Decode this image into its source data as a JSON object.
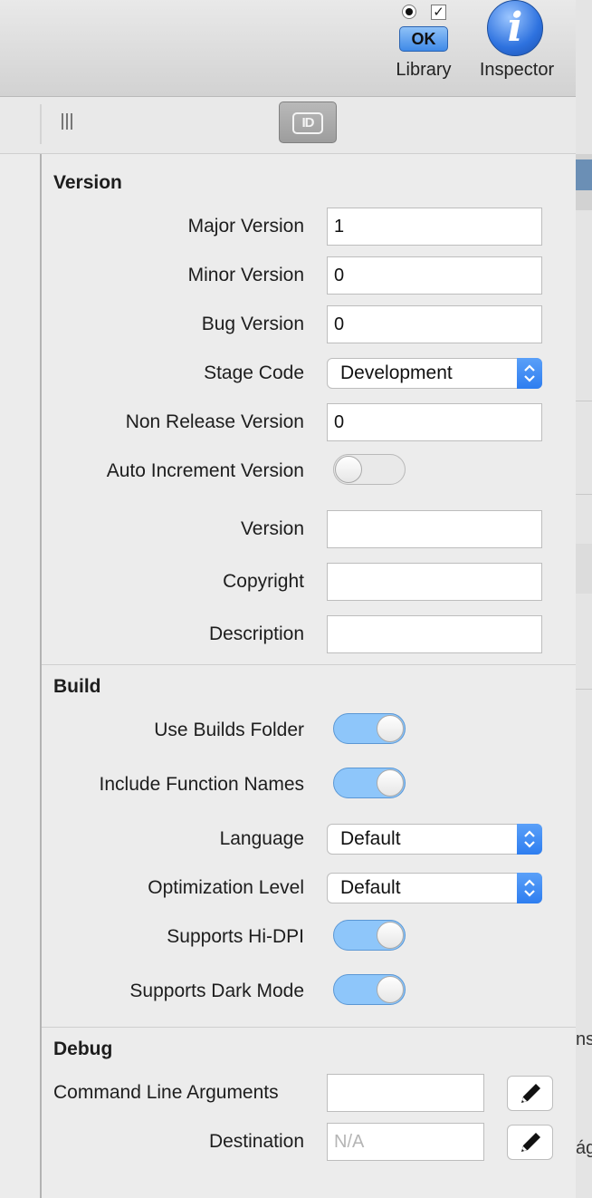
{
  "toolbar": {
    "library": {
      "label": "Library",
      "ok_text": "OK",
      "check_text": "✓"
    },
    "inspector": {
      "label": "Inspector",
      "glyph": "i"
    }
  },
  "tabs": {
    "id_tab_text": "ID"
  },
  "version": {
    "title": "Version",
    "major": {
      "label": "Major Version",
      "value": "1"
    },
    "minor": {
      "label": "Minor Version",
      "value": "0"
    },
    "bug": {
      "label": "Bug Version",
      "value": "0"
    },
    "stage": {
      "label": "Stage Code",
      "value": "Development"
    },
    "non_release": {
      "label": "Non Release Version",
      "value": "0"
    },
    "auto_increment": {
      "label": "Auto Increment Version",
      "on": false
    },
    "version_string": {
      "label": "Version",
      "value": ""
    },
    "copyright": {
      "label": "Copyright",
      "value": ""
    },
    "description": {
      "label": "Description",
      "value": ""
    }
  },
  "build": {
    "title": "Build",
    "use_builds_folder": {
      "label": "Use Builds Folder",
      "on": true
    },
    "include_function_names": {
      "label": "Include Function Names",
      "on": true
    },
    "language": {
      "label": "Language",
      "value": "Default"
    },
    "optimization": {
      "label": "Optimization Level",
      "value": "Default"
    },
    "hidpi": {
      "label": "Supports Hi-DPI",
      "on": true
    },
    "dark_mode": {
      "label": "Supports Dark Mode",
      "on": true
    }
  },
  "debug": {
    "title": "Debug",
    "args": {
      "label": "Command Line Arguments",
      "value": ""
    },
    "destination": {
      "label": "Destination",
      "placeholder": "N/A"
    }
  },
  "right_edge": {
    "text_1": "ns",
    "text_2": "ág"
  },
  "colors": {
    "toggle_on": "#8ec6fa",
    "popup_accent": "#2e7ef0",
    "ok_button": "#3f8ae8"
  }
}
